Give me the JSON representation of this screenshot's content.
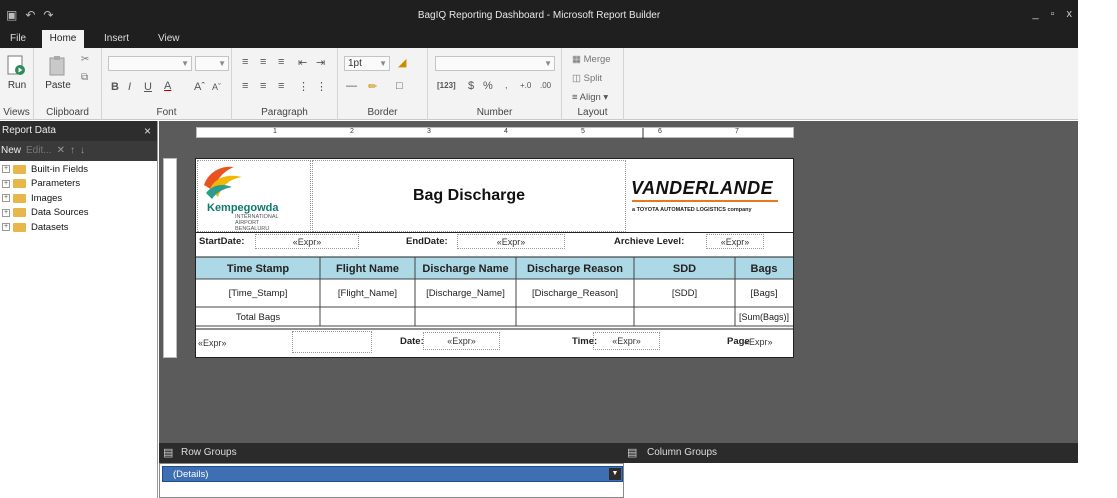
{
  "window": {
    "title": "BagIQ Reporting Dashboard - Microsoft Report Builder",
    "controls": [
      "_",
      "▫",
      "x"
    ]
  },
  "ribbon": {
    "tabs": [
      "File",
      "Home",
      "Insert",
      "View"
    ],
    "active_tab": "Home",
    "groups": {
      "views": "Views",
      "clipboard": "Clipboard",
      "font": "Font",
      "paragraph": "Paragraph",
      "border": "Border",
      "number": "Number",
      "layout": "Layout"
    },
    "run_label": "Run",
    "paste_label": "Paste",
    "border_size": "1pt",
    "merge_label": "Merge",
    "split_label": "Split",
    "align_label": "Align",
    "number_format_label": "[123]",
    "currency": "$",
    "percent": "%"
  },
  "report_data_panel": {
    "title": "Report Data",
    "close": "×",
    "toolbar_new": "New",
    "toolbar_edit": "Edit...",
    "items": [
      "Built-in Fields",
      "Parameters",
      "Images",
      "Data Sources",
      "Datasets"
    ]
  },
  "ruler": {
    "marks": [
      "1",
      "2",
      "3",
      "4",
      "5",
      "6",
      "7"
    ]
  },
  "report": {
    "title": "Bag Discharge",
    "left_logo": {
      "name": "Kempegowda",
      "line1": "INTERNATIONAL",
      "line2": "AIRPORT",
      "line3": "BENGALURU"
    },
    "right_logo": {
      "name": "VANDERLANDE",
      "tagline": "a TOYOTA AUTOMATED LOGISTICS company"
    },
    "params": {
      "start_label": "StartDate:",
      "start_value": "«Expr»",
      "end_label": "EndDate:",
      "end_value": "«Expr»",
      "archive_label": "Archieve Level:",
      "archive_value": "«Expr»"
    },
    "table": {
      "headers": [
        "Time Stamp",
        "Flight Name",
        "Discharge Name",
        "Discharge Reason",
        "SDD",
        "Bags"
      ],
      "detail": [
        "[Time_Stamp]",
        "[Flight_Name]",
        "[Discharge_Name]",
        "[Discharge_Reason]",
        "[SDD]",
        "[Bags]"
      ],
      "total_label": "Total Bags",
      "total_value": "[Sum(Bags)]"
    },
    "footer": {
      "expr1": "«Expr»",
      "date_label": "Date:",
      "date_value": "«Expr»",
      "time_label": "Time:",
      "time_value": "«Expr»",
      "page_label": "Page",
      "page_value": "«Expr»"
    }
  },
  "grouping": {
    "row_groups": "Row Groups",
    "column_groups": "Column Groups",
    "details": "(Details)"
  },
  "colors": {
    "header_fill": "#add8e6",
    "dark_chrome": "#1f1f1f",
    "canvas": "#5b5b5b",
    "selection": "#3e6fb3"
  }
}
